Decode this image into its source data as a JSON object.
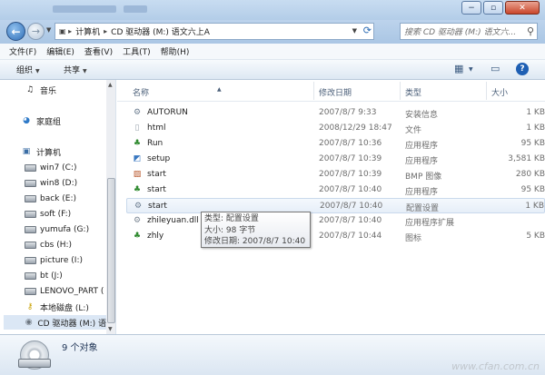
{
  "window": {
    "controls": [
      "−",
      "▫",
      "✕"
    ]
  },
  "address": {
    "segments": [
      "计算机",
      "CD 驱动器 (M:) 语文六上A"
    ],
    "search_placeholder": "搜索 CD 驱动器 (M:) 语文六..."
  },
  "menu": [
    "文件(F)",
    "编辑(E)",
    "查看(V)",
    "工具(T)",
    "帮助(H)"
  ],
  "toolbar": {
    "organize": "组织",
    "share": "共享"
  },
  "nav": {
    "items": [
      {
        "label": "音乐",
        "icon": "music-icon"
      },
      {
        "label": "家庭组",
        "icon": "homegroup-icon"
      },
      {
        "label": "计算机",
        "icon": "computer-icon"
      },
      {
        "label": "win7 (C:)",
        "icon": "drive-icon"
      },
      {
        "label": "win8 (D:)",
        "icon": "drive-icon"
      },
      {
        "label": "back (E:)",
        "icon": "drive-icon"
      },
      {
        "label": "soft (F:)",
        "icon": "drive-icon"
      },
      {
        "label": "yumufa (G:)",
        "icon": "drive-icon"
      },
      {
        "label": "cbs (H:)",
        "icon": "drive-icon"
      },
      {
        "label": "picture (I:)",
        "icon": "drive-icon"
      },
      {
        "label": "bt (J:)",
        "icon": "drive-icon"
      },
      {
        "label": "LENOVO_PART (",
        "icon": "drive-icon"
      },
      {
        "label": "本地磁盘 (L:)",
        "icon": "drive-icon"
      },
      {
        "label": "CD 驱动器 (M:) 语",
        "icon": "cd-drive-icon"
      }
    ]
  },
  "columns": {
    "name": "名称",
    "date": "修改日期",
    "type": "类型",
    "size": "大小"
  },
  "files": [
    {
      "name": "AUTORUN",
      "date": "2007/8/7 9:33",
      "type": "安装信息",
      "size": "1 KB",
      "icon": "settings-file-icon"
    },
    {
      "name": "html",
      "date": "2008/12/29 18:47",
      "type": "文件",
      "size": "1 KB",
      "icon": "blank-file-icon"
    },
    {
      "name": "Run",
      "date": "2007/8/7 10:36",
      "type": "应用程序",
      "size": "95 KB",
      "icon": "app-icon"
    },
    {
      "name": "setup",
      "date": "2007/8/7 10:39",
      "type": "应用程序",
      "size": "3,581 KB",
      "icon": "setup-icon"
    },
    {
      "name": "start",
      "date": "2007/8/7 10:39",
      "type": "BMP 图像",
      "size": "280 KB",
      "icon": "image-icon"
    },
    {
      "name": "start",
      "date": "2007/8/7 10:40",
      "type": "应用程序",
      "size": "95 KB",
      "icon": "app-icon"
    },
    {
      "name": "start",
      "date": "2007/8/7 10:40",
      "type": "配置设置",
      "size": "1 KB",
      "icon": "settings-file-icon"
    },
    {
      "name": "zhileyuan.dll",
      "date": "2007/8/7 10:40",
      "type": "应用程序扩展",
      "size": "",
      "icon": "dll-icon"
    },
    {
      "name": "zhly",
      "date": "2007/8/7 10:44",
      "type": "图标",
      "size": "5 KB",
      "icon": "app-icon"
    }
  ],
  "tooltip": {
    "type": "类型: 配置设置",
    "size": "大小: 98 字节",
    "date": "修改日期: 2007/8/7 10:40"
  },
  "status": {
    "count": "9 个对象"
  },
  "watermark": "www.cfan.com.cn"
}
